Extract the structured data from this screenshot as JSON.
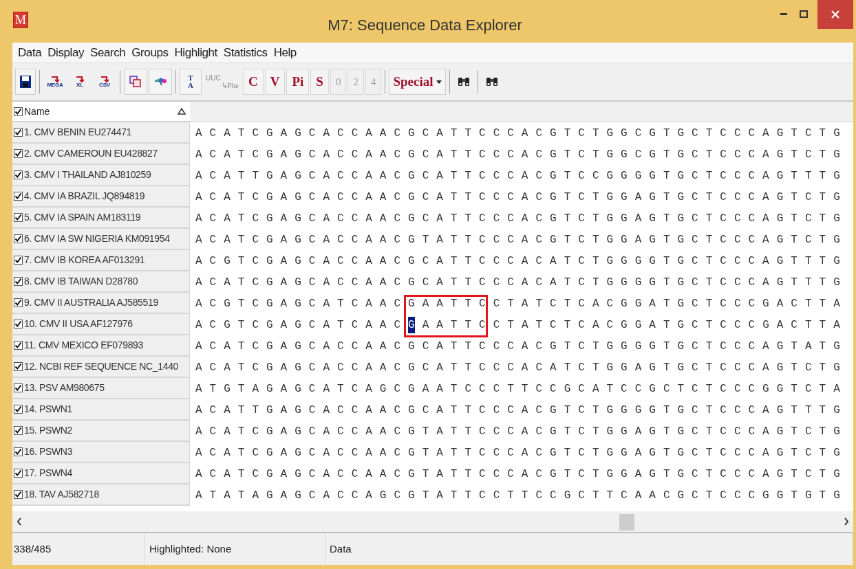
{
  "window": {
    "icon_letter": "M",
    "title": "M7: Sequence Data Explorer"
  },
  "menu": [
    "Data",
    "Display",
    "Search",
    "Groups",
    "Highlight",
    "Statistics",
    "Help"
  ],
  "toolbar": [
    {
      "kind": "save"
    },
    {
      "kind": "separator"
    },
    {
      "kind": "export",
      "label": "MEGA"
    },
    {
      "kind": "export",
      "label": "XL"
    },
    {
      "kind": "export",
      "label": "CSV"
    },
    {
      "kind": "separator"
    },
    {
      "kind": "copy"
    },
    {
      "kind": "translate"
    },
    {
      "kind": "separator"
    },
    {
      "kind": "stack",
      "labels": [
        "T",
        "A"
      ]
    },
    {
      "kind": "codon",
      "labels": [
        "UUC",
        "↳Phe"
      ],
      "disabled": true
    },
    {
      "kind": "letter",
      "label": "C",
      "disabled": false
    },
    {
      "kind": "letter",
      "label": "V",
      "disabled": false
    },
    {
      "kind": "letter",
      "label": "Pi",
      "disabled": false
    },
    {
      "kind": "letter",
      "label": "S",
      "disabled": false
    },
    {
      "kind": "letter",
      "label": "0",
      "disabled": true
    },
    {
      "kind": "letter",
      "label": "2",
      "disabled": true
    },
    {
      "kind": "letter",
      "label": "4",
      "disabled": true
    },
    {
      "kind": "separator"
    },
    {
      "kind": "dropdown",
      "label": "Special"
    },
    {
      "kind": "separator"
    },
    {
      "kind": "find"
    },
    {
      "kind": "separator"
    },
    {
      "kind": "find"
    }
  ],
  "name_header": {
    "label": "Name",
    "checked": true
  },
  "rows": [
    {
      "name": "1. CMV BENIN EU274471",
      "checked": true,
      "segments": [
        {
          "text": "A C A T C G A G C A C C A A C G C A T T C C C A C G T C T G G C G T G C T C C C A G T C T G",
          "selected": false
        }
      ]
    },
    {
      "name": "2. CMV CAMEROUN EU428827",
      "checked": true,
      "segments": [
        {
          "text": "A C A T C G A G C A C C A A C G C A T T C C C A C G T C T G G C G T G C T C C C A G T C T G",
          "selected": false
        }
      ]
    },
    {
      "name": "3. CMV I THAILAND AJ810259",
      "checked": true,
      "segments": [
        {
          "text": "A C A T T G A G C A C C A A C G C A T T C C C A C G T C C G G G G T G C T C C C A G T T T G",
          "selected": false
        }
      ]
    },
    {
      "name": "4. CMV IA BRAZIL JQ894819",
      "checked": true,
      "segments": [
        {
          "text": "A C A T C G A G C A C C A A C G C A T T C C C A C G T C T G G A G T G C T C C C A G T C T G",
          "selected": false
        }
      ]
    },
    {
      "name": "5. CMV IA SPAIN AM183119",
      "checked": true,
      "segments": [
        {
          "text": "A C A T C G A G C A C C A A C G C A T T C C C A C G T C T G G A G T G C T C C C A G T C T G",
          "selected": false
        }
      ]
    },
    {
      "name": "6. CMV IA SW NIGERIA KM091954",
      "checked": true,
      "segments": [
        {
          "text": "A C A T C G A G C A C C A A C G T A T T C C C A C G T C T G G A G T G C T C C C A G T C T G",
          "selected": false
        }
      ]
    },
    {
      "name": "7. CMV IB KOREA AF013291",
      "checked": true,
      "segments": [
        {
          "text": "A C G T C G A G C A C C A A C G C A T T C C C A C A T C T G G G G T G C T C C C A G T T T G",
          "selected": false
        }
      ]
    },
    {
      "name": "8. CMV IB TAIWAN D28780",
      "checked": true,
      "segments": [
        {
          "text": "A C A T C G A G C A C C A A C G C A T T C C C A C A T C T G G G G T G C T C C C A G T T T G",
          "selected": false
        }
      ]
    },
    {
      "name": "9. CMV II AUSTRALIA AJ585519",
      "checked": true,
      "segments": [
        {
          "text": "A C G T C G A G C A T C A A C G A A T T C C T A T C T C A C G G A T G C T C C C G A C T T A",
          "selected": false
        }
      ]
    },
    {
      "name": "10. CMV II USA AF127976",
      "checked": true,
      "segments": [
        {
          "text": "A C G T C G A G C A T C A A C",
          "selected": false
        },
        {
          "text": "G",
          "selected": true
        },
        {
          "text": "A A T T C C T A T C T C A C G G A T G C T C C C G A C T T A",
          "selected": false
        }
      ]
    },
    {
      "name": "11. CMV MEXICO EF079893",
      "checked": true,
      "segments": [
        {
          "text": "A C A T C G A G C A C C A A C G C A T T C C C A C G T C T G G G G T G C T C C C A G T A T G",
          "selected": false
        }
      ]
    },
    {
      "name": "12. NCBI REF SEQUENCE NC_1440",
      "checked": true,
      "segments": [
        {
          "text": "A C A T C G A G C A C C A A C G C A T T C C C A C A T C T G G A G T G C T C C C A G T C T G",
          "selected": false
        }
      ]
    },
    {
      "name": "13. PSV AM980675",
      "checked": true,
      "segments": [
        {
          "text": "A T G T A G A G C A T C A G C G A A T C C C T T C C G C A T C C G C T C T C C C G G T C T A",
          "selected": false
        }
      ]
    },
    {
      "name": "14. PSWN1",
      "checked": true,
      "segments": [
        {
          "text": "A C A T T G A G C A C C A A C G C A T T C C C A C G T C T G G G G T G C T C C C A G T T T G",
          "selected": false
        }
      ]
    },
    {
      "name": "15. PSWN2",
      "checked": true,
      "segments": [
        {
          "text": "A C A T C G A G C A C C A A C G T A T T C C C A C G T C T G G A G T G C T C C C A G T C T G",
          "selected": false
        }
      ]
    },
    {
      "name": "16. PSWN3",
      "checked": true,
      "segments": [
        {
          "text": "A C A T C G A G C A C C A A C G T A T T C C C A C G T C T G G A G T G C T C C C A G T C T G",
          "selected": false
        }
      ]
    },
    {
      "name": "17. PSWN4",
      "checked": true,
      "segments": [
        {
          "text": "A C A T C G A G C A C C A A C G T A T T C C C A C G T C T G G A G T G C T C C C A G T C T G",
          "selected": false
        }
      ]
    },
    {
      "name": "18. TAV AJ582718",
      "checked": true,
      "segments": [
        {
          "text": "A T A T A G A G C A C C A G C G T A T T C C T T C C G C T T C A A C G C T C C C G G T G T G",
          "selected": false
        }
      ]
    }
  ],
  "status_bar": [
    "338/485",
    "Highlighted: None",
    "Data"
  ]
}
